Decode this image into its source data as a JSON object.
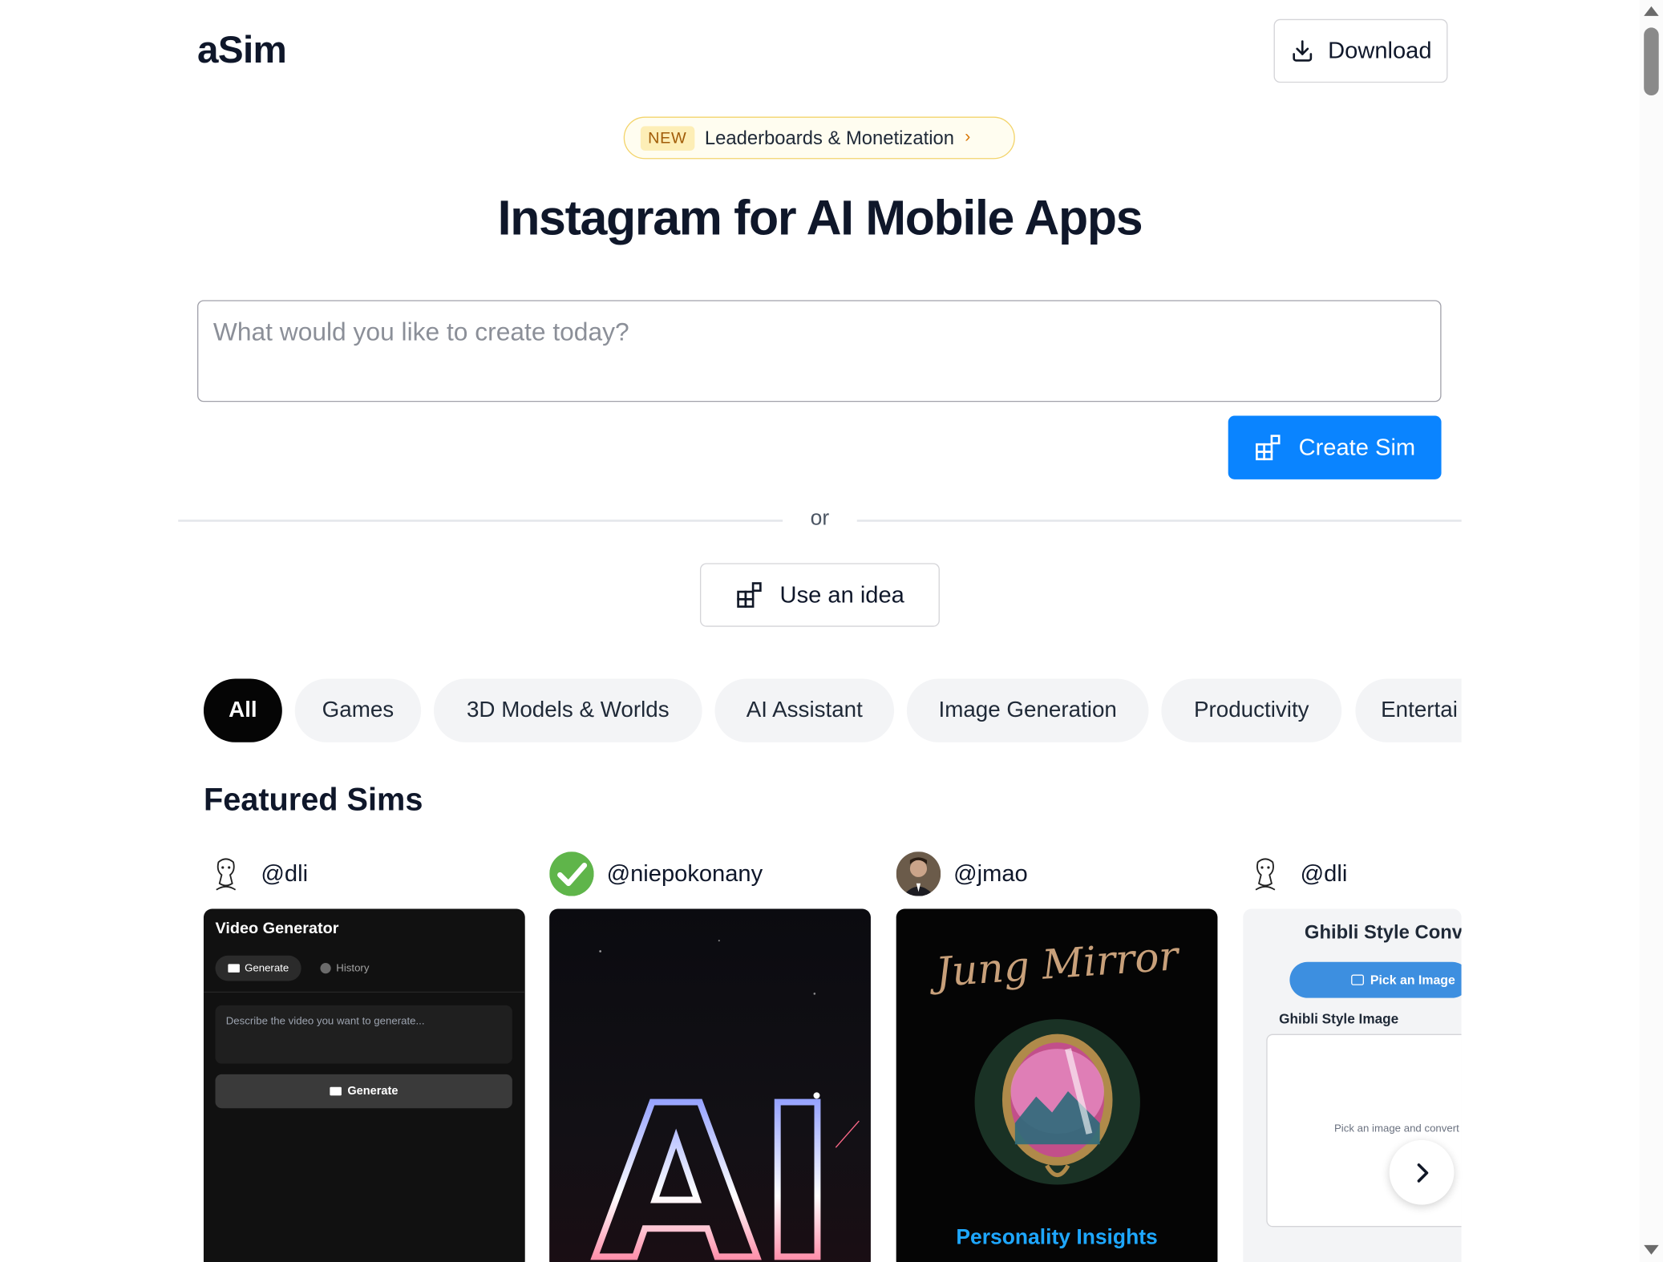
{
  "header": {
    "logo": "aSim",
    "download_label": "Download"
  },
  "announcement": {
    "badge": "NEW",
    "text": "Leaderboards & Monetization"
  },
  "hero": {
    "title": "Instagram for AI Mobile Apps"
  },
  "prompt": {
    "placeholder": "What would you like to create today?",
    "value": ""
  },
  "actions": {
    "create_label": "Create Sim",
    "or_label": "or",
    "idea_label": "Use an idea"
  },
  "categories": [
    {
      "label": "All",
      "active": true
    },
    {
      "label": "Games",
      "active": false
    },
    {
      "label": "3D Models & Worlds",
      "active": false
    },
    {
      "label": "AI Assistant",
      "active": false
    },
    {
      "label": "Image Generation",
      "active": false
    },
    {
      "label": "Productivity",
      "active": false
    },
    {
      "label": "Entertai",
      "active": false
    }
  ],
  "featured": {
    "title": "Featured Sims",
    "cards": [
      {
        "author": "@dli",
        "avatar_icon": "sketch-character-avatar",
        "preview": {
          "title": "Video Generator",
          "tab_generate": "Generate",
          "tab_history": "History",
          "textarea_placeholder": "Describe the video you want to generate...",
          "button": "Generate"
        }
      },
      {
        "author": "@niepokonany",
        "avatar_icon": "green-check-avatar",
        "preview": {
          "text": "AI"
        }
      },
      {
        "author": "@jmao",
        "avatar_icon": "photo-avatar",
        "preview": {
          "title": "Jung Mirror",
          "subtitle": "Personality Insights"
        }
      },
      {
        "author": "@dli",
        "avatar_icon": "sketch-character-avatar",
        "preview": {
          "title": "Ghibli Style Conv",
          "button": "Pick an Image",
          "label": "Ghibli Style Image",
          "hint": "Pick an image and convert"
        }
      }
    ]
  },
  "colors": {
    "accent": "#0a84ff",
    "text": "#0f172a",
    "chip_bg": "#f3f4f6",
    "chip_active_bg": "#050505",
    "badge_border": "#f3d46b"
  }
}
